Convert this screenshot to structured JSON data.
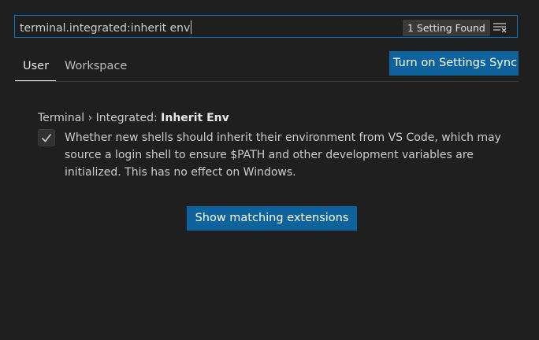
{
  "search": {
    "value": "terminal.integrated:inherit env",
    "result_count": "1 Setting Found",
    "clear_filter_icon": "clear-filter-icon"
  },
  "tabs": [
    {
      "label": "User",
      "active": true
    },
    {
      "label": "Workspace",
      "active": false
    }
  ],
  "sync_button": {
    "label": "Turn on Settings Sync"
  },
  "setting": {
    "category": "Terminal › Integrated: ",
    "name": "Inherit Env",
    "checked": true,
    "description": "Whether new shells should inherit their environment from VS Code, which may source a login shell to ensure $PATH and other development variables are initialized. This has no effect on Windows."
  },
  "extensions_button": {
    "label": "Show matching extensions"
  },
  "colors": {
    "background": "#1f1f1f",
    "focus_border": "#0078d4",
    "button": "#0e639c"
  }
}
